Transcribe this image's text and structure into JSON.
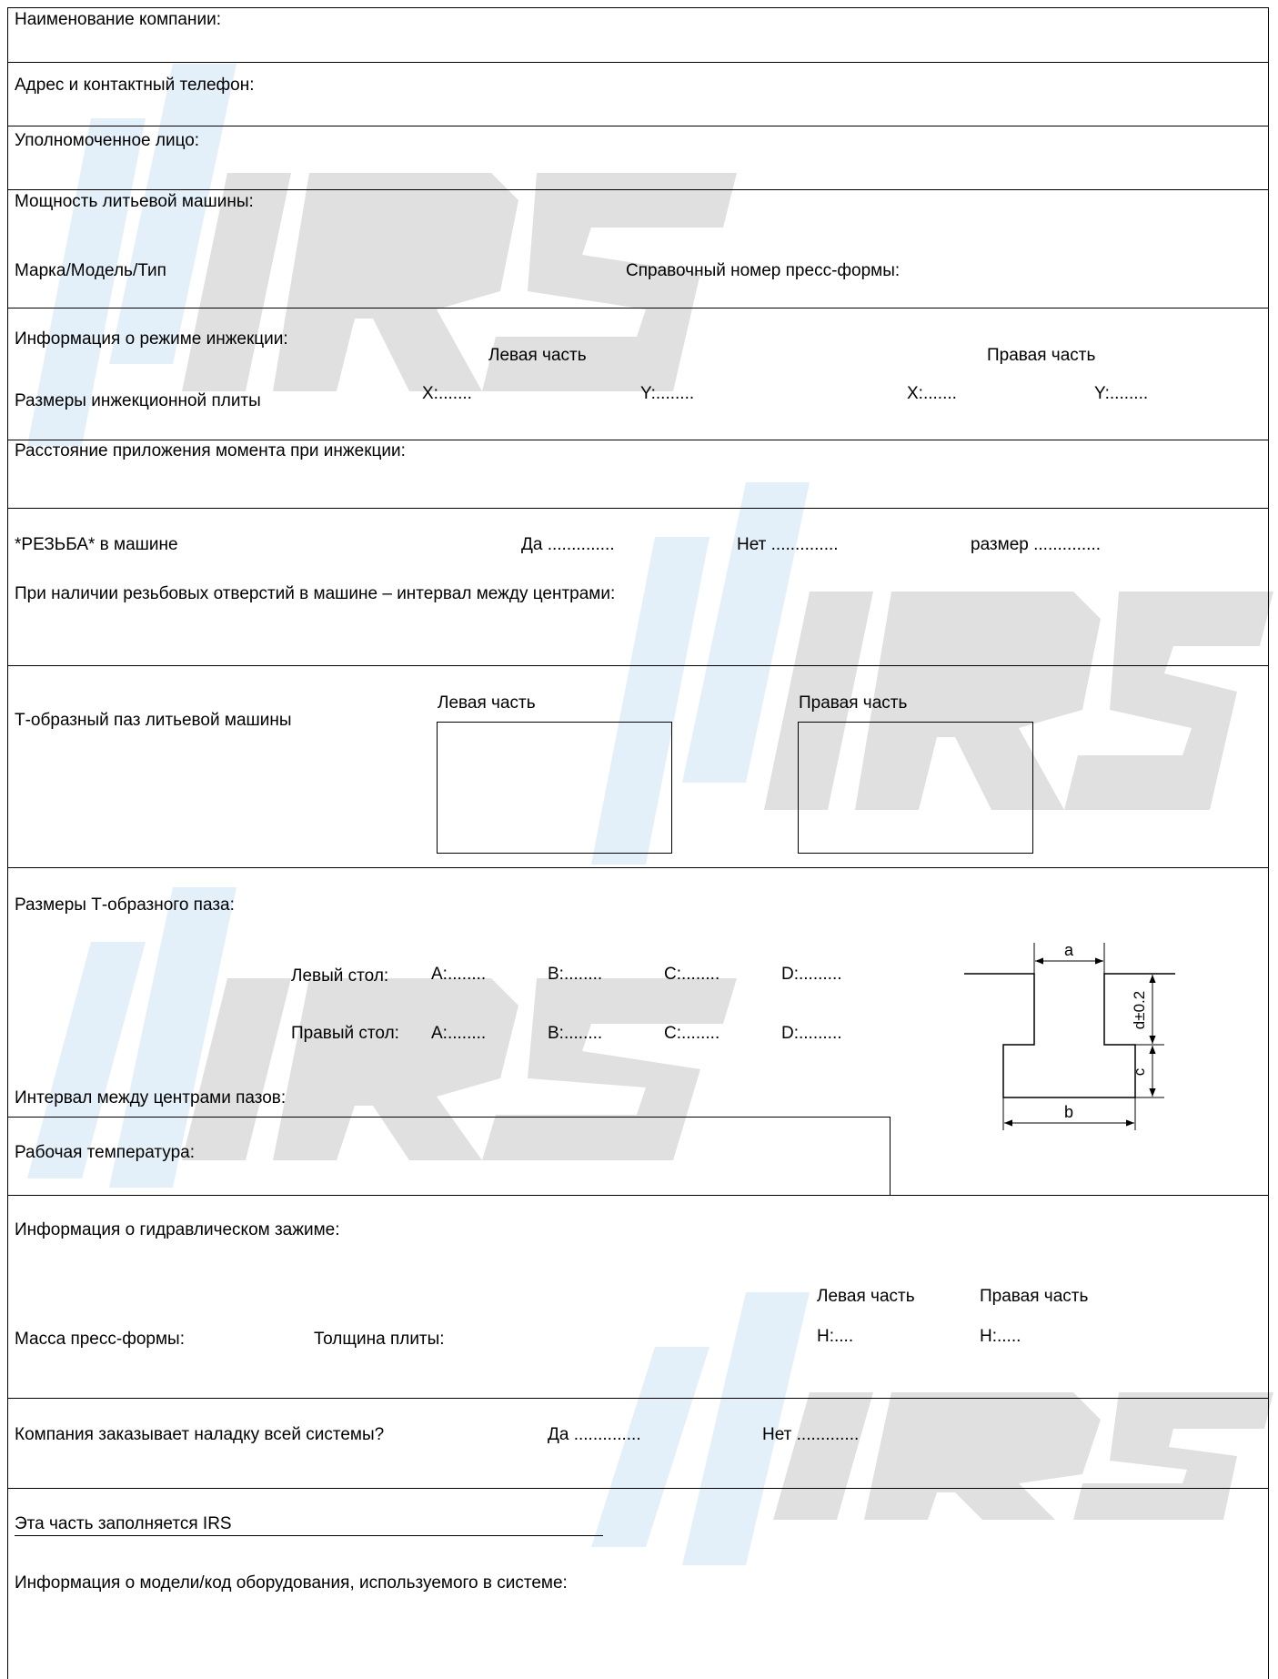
{
  "watermark": {
    "brand": "iRS",
    "colors": {
      "gray": "#dedede",
      "blue": "#e0eef8"
    }
  },
  "company": {
    "name_label": "Наименование компании:",
    "address_label": "Адрес и контактный телефон:",
    "authorized_label": "Уполномоченное лицо:"
  },
  "machine": {
    "power_label": "Мощность литьевой машины:",
    "brand_label": "Марка/Модель/Тип",
    "mold_ref_label": "Справочный номер пресс-формы:"
  },
  "injection": {
    "info_label": "Информация о режиме инжекции:",
    "left_part": "Левая часть",
    "right_part": "Правая часть",
    "plate_size_label": "Размеры инжекционной плиты",
    "left_x": "X:.......",
    "left_y": "Y:........",
    "right_x": "X:.......",
    "right_y": "Y:........"
  },
  "torque": {
    "label": "Расстояние приложения момента при инжекции:"
  },
  "thread": {
    "label": "*РЕЗЬБА* в машине",
    "yes": "Да ..............",
    "no": "Нет ..............",
    "size": "размер ..............",
    "interval_label": "При наличии резьбовых отверстий в машине – интервал между центрами:"
  },
  "tslot": {
    "label": "Т-образный паз литьевой машины",
    "left_part": "Левая часть",
    "right_part": "Правая часть"
  },
  "tslot_dims": {
    "label": "Размеры Т-образного паза:",
    "left_table": "Левый стол:",
    "right_table": "Правый стол:",
    "left_a": "A:........",
    "left_b": "B:........",
    "left_c": "C:........",
    "left_d": "D:.........",
    "right_a": "A:........",
    "right_b": "B:........",
    "right_c": "C:........",
    "right_d": "D:.........",
    "center_interval_label": "Интервал между центрами пазов:",
    "drawing": {
      "dim_a": "a",
      "dim_b": "b",
      "dim_c": "c",
      "dim_d": "d±0.2"
    }
  },
  "temperature": {
    "label": "Рабочая температура:"
  },
  "hydraulic": {
    "label": "Информация о гидравлическом зажиме:",
    "left_part": "Левая часть",
    "right_part": "Правая часть",
    "mold_mass_label": "Масса пресс-формы:",
    "plate_thickness_label": "Толщина плиты:",
    "left_h": "H:....",
    "right_h": "H:....."
  },
  "setup": {
    "question": "Компания заказывает наладку всей системы?",
    "yes": "Да ..............",
    "no": "Нет ............."
  },
  "irs_section": {
    "title": "Эта часть заполняется IRS",
    "equipment_label": "Информация о модели/код оборудования, используемого в системе:"
  }
}
